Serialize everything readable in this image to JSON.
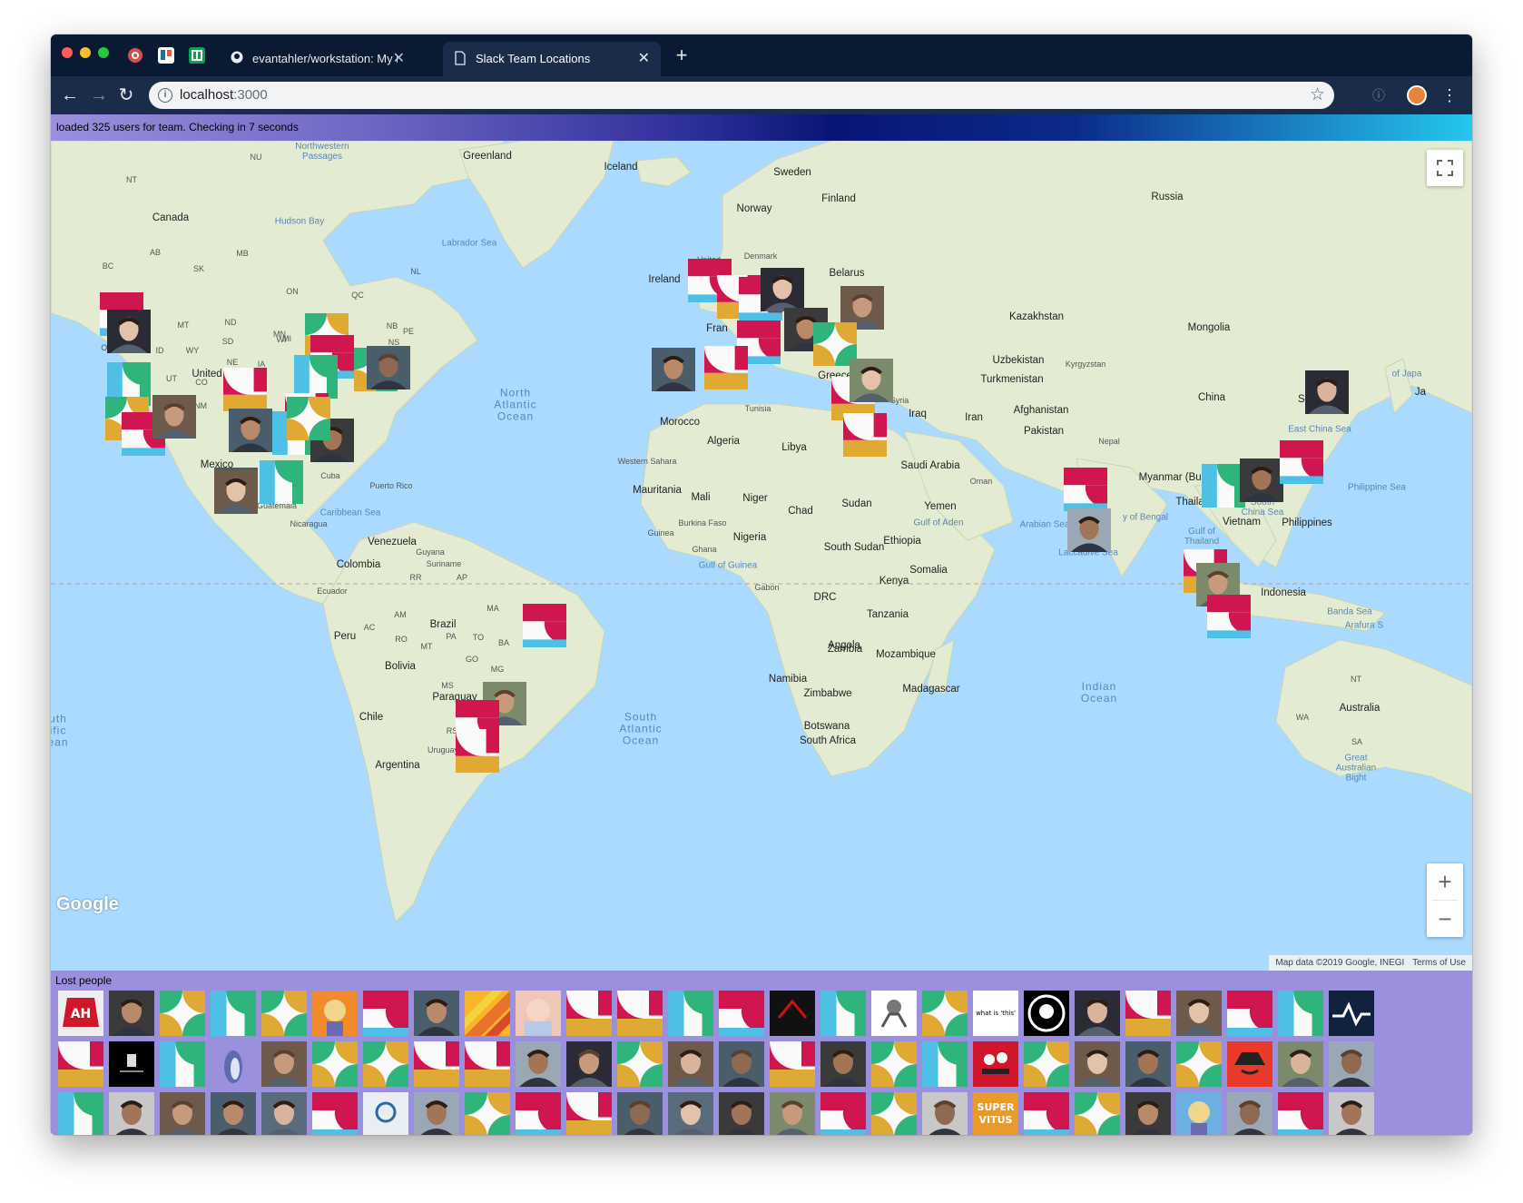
{
  "browser": {
    "tabs": [
      {
        "label": "evantahler/workstation: My ren",
        "active": false,
        "icon": "github-icon"
      },
      {
        "label": "Slack Team Locations",
        "active": true,
        "icon": "document-icon"
      }
    ],
    "pinned_tabs": [
      "extension-icon",
      "trello-icon",
      "sheets-icon"
    ],
    "url_host": "localhost",
    "url_port": ":3000"
  },
  "status": {
    "text": "loaded 325 users for team. Checking in 7 seconds"
  },
  "map": {
    "logo": "Google",
    "attribution": "Map data ©2019 Google, INEGI",
    "terms": "Terms of Use",
    "labels": [
      {
        "t": "Greenland",
        "c": "big"
      },
      {
        "t": "Iceland",
        "c": "big"
      },
      {
        "t": "Sweden",
        "c": "big"
      },
      {
        "t": "Finland",
        "c": "big"
      },
      {
        "t": "Norway",
        "c": "big"
      },
      {
        "t": "Russia",
        "c": "big"
      },
      {
        "t": "Canada",
        "c": "big"
      },
      {
        "t": "Hudson Bay",
        "c": "sea"
      },
      {
        "t": "Labrador Sea",
        "c": "sea"
      },
      {
        "t": "Northwestern\nPassages",
        "c": "sea"
      },
      {
        "t": "NU",
        "c": "small"
      },
      {
        "t": "NT",
        "c": "small"
      },
      {
        "t": "BC",
        "c": "small"
      },
      {
        "t": "AB",
        "c": "small"
      },
      {
        "t": "SK",
        "c": "small"
      },
      {
        "t": "MB",
        "c": "small"
      },
      {
        "t": "ON",
        "c": "small"
      },
      {
        "t": "QC",
        "c": "small"
      },
      {
        "t": "NL",
        "c": "small"
      },
      {
        "t": "NB",
        "c": "small"
      },
      {
        "t": "PE",
        "c": "small"
      },
      {
        "t": "NS",
        "c": "small"
      },
      {
        "t": "MT",
        "c": "small"
      },
      {
        "t": "ND",
        "c": "small"
      },
      {
        "t": "SD",
        "c": "small"
      },
      {
        "t": "MN",
        "c": "small"
      },
      {
        "t": "WY",
        "c": "small"
      },
      {
        "t": "ID",
        "c": "small"
      },
      {
        "t": "OR",
        "c": "small"
      },
      {
        "t": "NE",
        "c": "small"
      },
      {
        "t": "IA",
        "c": "small"
      },
      {
        "t": "WI",
        "c": "small"
      },
      {
        "t": "MI",
        "c": "small"
      },
      {
        "t": "UT",
        "c": "small"
      },
      {
        "t": "CO",
        "c": "small"
      },
      {
        "t": "NM",
        "c": "small"
      },
      {
        "t": "United",
        "c": "big"
      },
      {
        "t": "Mexico",
        "c": "big"
      },
      {
        "t": "Cuba",
        "c": "small"
      },
      {
        "t": "Puerto Rico",
        "c": "small"
      },
      {
        "t": "Caribbean Sea",
        "c": "sea"
      },
      {
        "t": "Guatemala",
        "c": "small"
      },
      {
        "t": "Nicaragua",
        "c": "small"
      },
      {
        "t": "Venezuela",
        "c": "big"
      },
      {
        "t": "Guyana",
        "c": "small"
      },
      {
        "t": "Suriname",
        "c": "small"
      },
      {
        "t": "Colombia",
        "c": "big"
      },
      {
        "t": "Ecuador",
        "c": "small"
      },
      {
        "t": "Peru",
        "c": "big"
      },
      {
        "t": "Brazil",
        "c": "big"
      },
      {
        "t": "Bolivia",
        "c": "big"
      },
      {
        "t": "Paraguay",
        "c": "big"
      },
      {
        "t": "Chile",
        "c": "big"
      },
      {
        "t": "Argentina",
        "c": "big"
      },
      {
        "t": "Uruguay",
        "c": "small"
      },
      {
        "t": "AM",
        "c": "small"
      },
      {
        "t": "PA",
        "c": "small"
      },
      {
        "t": "MA",
        "c": "small"
      },
      {
        "t": "AC",
        "c": "small"
      },
      {
        "t": "RO",
        "c": "small"
      },
      {
        "t": "MT",
        "c": "small"
      },
      {
        "t": "TO",
        "c": "small"
      },
      {
        "t": "BA",
        "c": "small"
      },
      {
        "t": "GO",
        "c": "small"
      },
      {
        "t": "MG",
        "c": "small"
      },
      {
        "t": "MS",
        "c": "small"
      },
      {
        "t": "RS",
        "c": "small"
      },
      {
        "t": "RR",
        "c": "small"
      },
      {
        "t": "AP",
        "c": "small"
      },
      {
        "t": "North\nAtlantic\nOcean",
        "c": "ocean"
      },
      {
        "t": "South\nAtlantic\nOcean",
        "c": "ocean"
      },
      {
        "t": "Indian\nOcean",
        "c": "ocean"
      },
      {
        "t": "uth\nific\nean",
        "c": "ocean"
      },
      {
        "t": "Ireland",
        "c": "big"
      },
      {
        "t": "United",
        "c": "small"
      },
      {
        "t": "Denmark",
        "c": "small"
      },
      {
        "t": "Belarus",
        "c": "big"
      },
      {
        "t": "Fran",
        "c": "big"
      },
      {
        "t": "Greece",
        "c": "big"
      },
      {
        "t": "Tunisia",
        "c": "small"
      },
      {
        "t": "Morocco",
        "c": "big"
      },
      {
        "t": "Algeria",
        "c": "big"
      },
      {
        "t": "Libya",
        "c": "big"
      },
      {
        "t": "Western\nSahara",
        "c": "small"
      },
      {
        "t": "Mauritania",
        "c": "big"
      },
      {
        "t": "Mali",
        "c": "big"
      },
      {
        "t": "Niger",
        "c": "big"
      },
      {
        "t": "Chad",
        "c": "big"
      },
      {
        "t": "Sudan",
        "c": "big"
      },
      {
        "t": "Burkina\nFaso",
        "c": "small"
      },
      {
        "t": "Guinea",
        "c": "small"
      },
      {
        "t": "Ghana",
        "c": "small"
      },
      {
        "t": "Nigeria",
        "c": "big"
      },
      {
        "t": "Gulf of Guinea",
        "c": "sea"
      },
      {
        "t": "Gabon",
        "c": "small"
      },
      {
        "t": "DRC",
        "c": "big"
      },
      {
        "t": "South Sudan",
        "c": "big"
      },
      {
        "t": "Ethiopia",
        "c": "big"
      },
      {
        "t": "Somalia",
        "c": "big"
      },
      {
        "t": "Kenya",
        "c": "big"
      },
      {
        "t": "Tanzania",
        "c": "big"
      },
      {
        "t": "Angola",
        "c": "big"
      },
      {
        "t": "Zambia",
        "c": "big"
      },
      {
        "t": "Mozambique",
        "c": "big"
      },
      {
        "t": "Namibia",
        "c": "big"
      },
      {
        "t": "Zimbabwe",
        "c": "big"
      },
      {
        "t": "Botswana",
        "c": "big"
      },
      {
        "t": "Madagascar",
        "c": "big"
      },
      {
        "t": "South Africa",
        "c": "big"
      },
      {
        "t": "Saudi Arabia",
        "c": "big"
      },
      {
        "t": "Yemen",
        "c": "big"
      },
      {
        "t": "Oman",
        "c": "small"
      },
      {
        "t": "Gulf of Aden",
        "c": "sea"
      },
      {
        "t": "Arabian Sea",
        "c": "sea"
      },
      {
        "t": "Iraq",
        "c": "big"
      },
      {
        "t": "Iran",
        "c": "big"
      },
      {
        "t": "Syria",
        "c": "small"
      },
      {
        "t": "Kazakhstan",
        "c": "big"
      },
      {
        "t": "Uzbekistan",
        "c": "big"
      },
      {
        "t": "Kyrgyzstan",
        "c": "small"
      },
      {
        "t": "Turkmenistan",
        "c": "big"
      },
      {
        "t": "Afghanistan",
        "c": "big"
      },
      {
        "t": "Pakistan",
        "c": "big"
      },
      {
        "t": "Nepal",
        "c": "small"
      },
      {
        "t": "China",
        "c": "big"
      },
      {
        "t": "Mongolia",
        "c": "big"
      },
      {
        "t": "Myanmar\n(Burma)",
        "c": "big"
      },
      {
        "t": "Thaila",
        "c": "big"
      },
      {
        "t": "Vietnam",
        "c": "big"
      },
      {
        "t": "Philippines",
        "c": "big"
      },
      {
        "t": "y of Bengal",
        "c": "sea"
      },
      {
        "t": "Laccadive Sea",
        "c": "sea"
      },
      {
        "t": "Gulf of\nThailand",
        "c": "sea"
      },
      {
        "t": "South\nChina Sea",
        "c": "sea"
      },
      {
        "t": "Philippine Sea",
        "c": "sea"
      },
      {
        "t": "East China Sea",
        "c": "sea"
      },
      {
        "t": "of Japa",
        "c": "sea"
      },
      {
        "t": "Ja",
        "c": "big"
      },
      {
        "t": "So",
        "c": "big"
      },
      {
        "t": "Indonesia",
        "c": "big"
      },
      {
        "t": "Banda Sea",
        "c": "sea"
      },
      {
        "t": "Arafura S",
        "c": "sea"
      },
      {
        "t": "Australia",
        "c": "big"
      },
      {
        "t": "NT",
        "c": "small"
      },
      {
        "t": "WA",
        "c": "small"
      },
      {
        "t": "SA",
        "c": "small"
      },
      {
        "t": "Great\nAustralian\nBight",
        "c": "sea"
      }
    ],
    "markers_count": 46
  },
  "lost_people": {
    "title": "Lost people",
    "tile_texts": {
      "what_is_this": "what is 'this'",
      "super_virtus": "SUPER\nVITUS"
    },
    "rows": 3,
    "per_row": 26
  },
  "colors": {
    "slack_red": "#d0164f",
    "slack_blue": "#4ec0e5",
    "slack_green": "#2fb47c",
    "slack_yellow": "#e0a934",
    "panel_purple": "#9a90dd",
    "ocean": "#aadaff",
    "land": "#e4ecd4"
  }
}
